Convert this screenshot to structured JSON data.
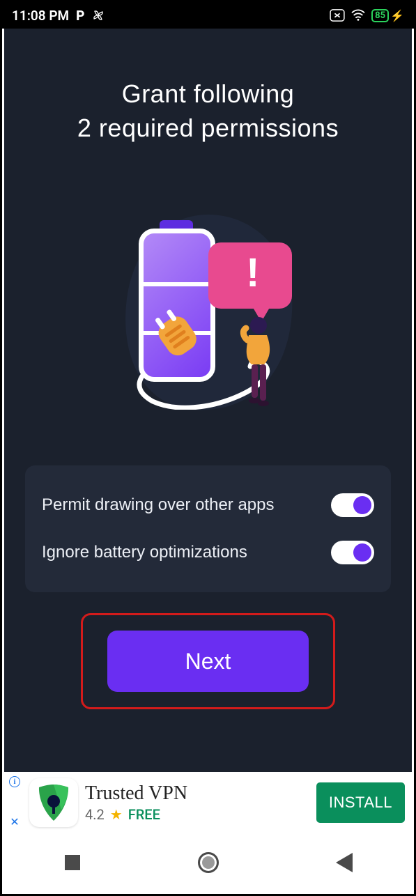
{
  "statusbar": {
    "time": "11:08 PM",
    "p_label": "P",
    "battery": "85"
  },
  "title_line1": "Grant following",
  "title_line2": "2 required permissions",
  "permissions": [
    {
      "label": "Permit drawing over other apps"
    },
    {
      "label": "Ignore battery optimizations"
    }
  ],
  "next_label": "Next",
  "ad": {
    "title": "Trusted VPN",
    "rating": "4.2",
    "price": "FREE",
    "cta": "INSTALL"
  }
}
